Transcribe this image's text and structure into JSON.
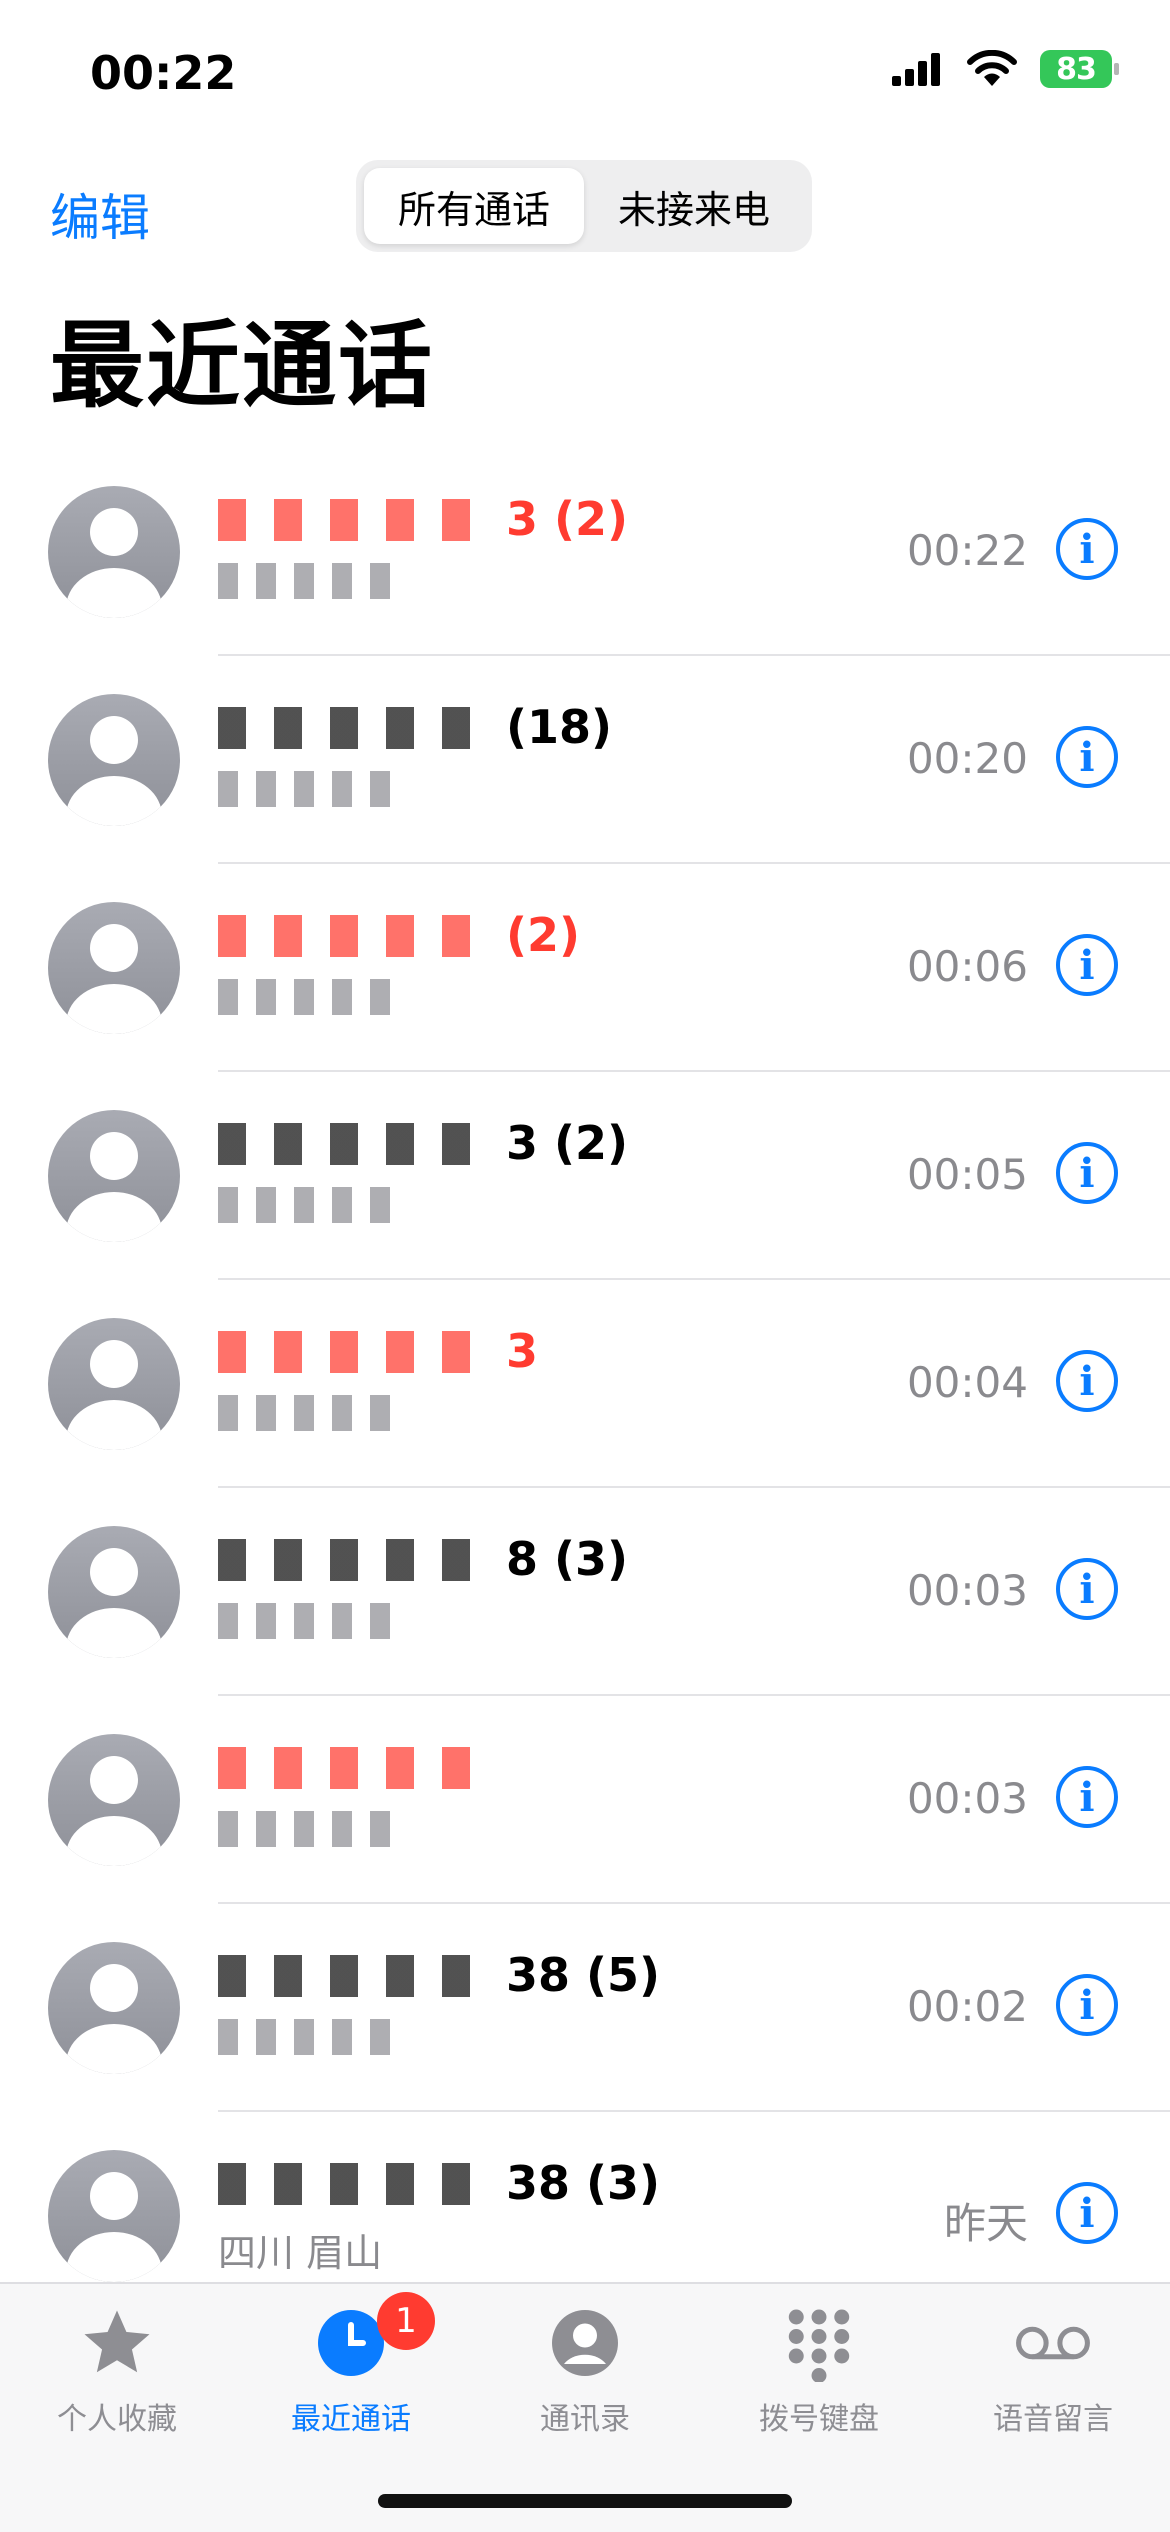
{
  "status_bar": {
    "time": "00:22",
    "battery": "83",
    "battery_color": "#34c759"
  },
  "header": {
    "edit_label": "编辑",
    "segments": [
      "所有通话",
      "未接来电"
    ],
    "title": "最近通话"
  },
  "calls": [
    {
      "name_suffix": "3 (2)",
      "missed": true,
      "sub": "",
      "time": "00:22"
    },
    {
      "name_suffix": "(18)",
      "missed": false,
      "sub": "",
      "time": "00:20"
    },
    {
      "name_suffix": "(2)",
      "missed": true,
      "sub": "",
      "time": "00:06"
    },
    {
      "name_suffix": "3 (2)",
      "missed": false,
      "sub": "",
      "time": "00:05"
    },
    {
      "name_suffix": "3",
      "missed": true,
      "sub": "",
      "time": "00:04"
    },
    {
      "name_suffix": "8 (3)",
      "missed": false,
      "sub": "",
      "time": "00:03"
    },
    {
      "name_suffix": "",
      "missed": true,
      "sub": "",
      "time": "00:03"
    },
    {
      "name_suffix": "38 (5)",
      "missed": false,
      "sub": "",
      "time": "00:02"
    },
    {
      "name_suffix": "38 (3)",
      "missed": false,
      "sub": "四川 眉山",
      "time": "昨天"
    }
  ],
  "tabs": [
    {
      "label": "个人收藏",
      "icon": "star-icon"
    },
    {
      "label": "最近通话",
      "icon": "clock-icon",
      "badge": "1",
      "active": true
    },
    {
      "label": "通讯录",
      "icon": "contact-icon"
    },
    {
      "label": "拨号键盘",
      "icon": "keypad-icon"
    },
    {
      "label": "语音留言",
      "icon": "voicemail-icon"
    }
  ],
  "colors": {
    "accent": "#0a7cff",
    "missed": "#ff3b30",
    "secondary_text": "#8a8a8e"
  }
}
